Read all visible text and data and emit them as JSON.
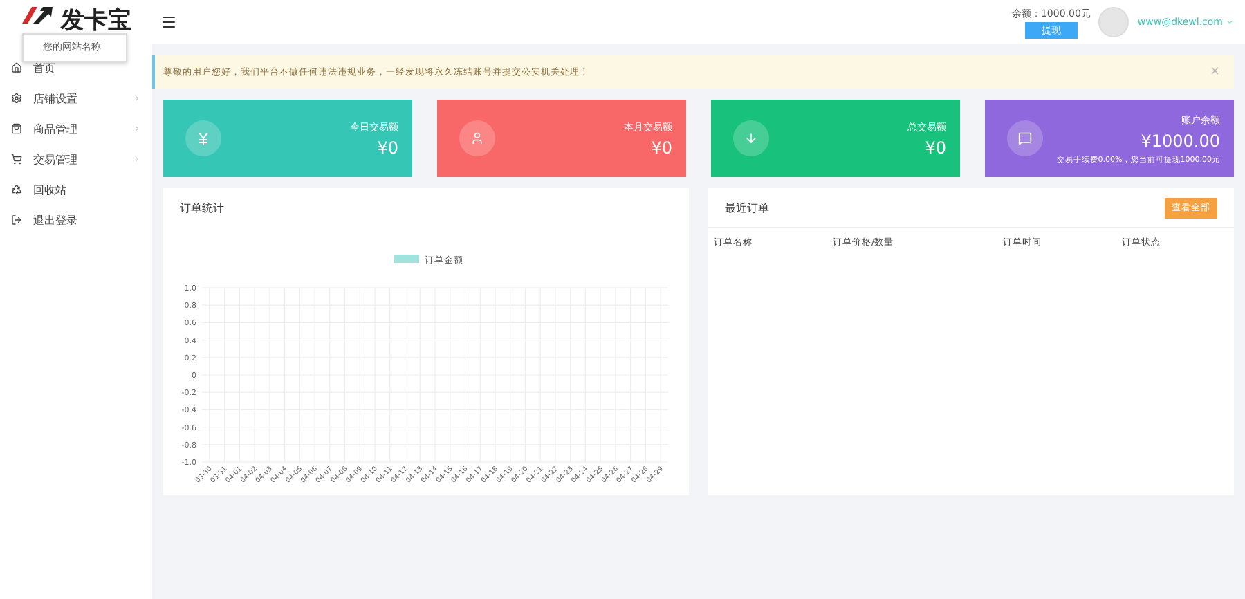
{
  "brand": {
    "name": "发卡宝",
    "tooltip": "您的网站名称"
  },
  "sidebar": {
    "items": [
      {
        "label": "首页",
        "has_arrow": false
      },
      {
        "label": "店铺设置",
        "has_arrow": true
      },
      {
        "label": "商品管理",
        "has_arrow": true
      },
      {
        "label": "交易管理",
        "has_arrow": true
      },
      {
        "label": "回收站",
        "has_arrow": false
      },
      {
        "label": "退出登录",
        "has_arrow": false
      }
    ]
  },
  "header": {
    "balance": "余额：1000.00元",
    "withdraw": "提现",
    "user": "www@dkewl.com"
  },
  "notice": {
    "text": "尊敬的用户您好，我们平台不做任何违法违规业务，一经发现将永久冻结账号并提交公安机关处理！",
    "close": "×"
  },
  "stats": [
    {
      "label": "今日交易额",
      "value": "¥0",
      "color": "#36c6b5"
    },
    {
      "label": "本月交易额",
      "value": "¥0",
      "color": "#f96868"
    },
    {
      "label": "总交易额",
      "value": "¥0",
      "color": "#19c27c"
    },
    {
      "label": "账户余额",
      "value": "¥1000.00",
      "color": "#9068dd",
      "note": "交易手续费0.00%，您当前可提现1000.00元"
    }
  ],
  "order_chart": {
    "title": "订单统计",
    "chart_data": {
      "type": "line",
      "x": [
        "03-30",
        "03-31",
        "04-01",
        "04-02",
        "04-03",
        "04-04",
        "04-05",
        "04-06",
        "04-07",
        "04-08",
        "04-09",
        "04-10",
        "04-11",
        "04-12",
        "04-13",
        "04-14",
        "04-15",
        "04-16",
        "04-17",
        "04-18",
        "04-19",
        "04-20",
        "04-21",
        "04-22",
        "04-23",
        "04-24",
        "04-25",
        "04-26",
        "04-27",
        "04-28",
        "04-29"
      ],
      "series": [
        {
          "name": "订单金额",
          "color": "#9fe3dc",
          "values": [
            null,
            null,
            null,
            null,
            null,
            null,
            null,
            null,
            null,
            null,
            null,
            null,
            null,
            null,
            null,
            null,
            null,
            null,
            null,
            null,
            null,
            null,
            null,
            null,
            null,
            null,
            null,
            null,
            null,
            null,
            null
          ]
        }
      ],
      "grid": true,
      "ylim": [
        -1,
        1
      ],
      "yticks": [
        {
          "value": 1,
          "label": "1.0"
        },
        {
          "value": 0.8,
          "label": "0.8"
        },
        {
          "value": 0.6,
          "label": "0.6"
        },
        {
          "value": 0.4,
          "label": "0.4"
        },
        {
          "value": 0.2,
          "label": "0.2"
        },
        {
          "value": 0,
          "label": "0"
        },
        {
          "value": -0.2,
          "label": "-0.2"
        },
        {
          "value": -0.4,
          "label": "-0.4"
        },
        {
          "value": -0.6,
          "label": "-0.6"
        },
        {
          "value": -0.8,
          "label": "-0.8"
        },
        {
          "value": -1,
          "label": "-1.0"
        }
      ]
    }
  },
  "recent_orders": {
    "title": "最近订单",
    "view_all": "查看全部",
    "columns": [
      "订单名称",
      "订单价格/数量",
      "订单时间",
      "订单状态"
    ]
  }
}
